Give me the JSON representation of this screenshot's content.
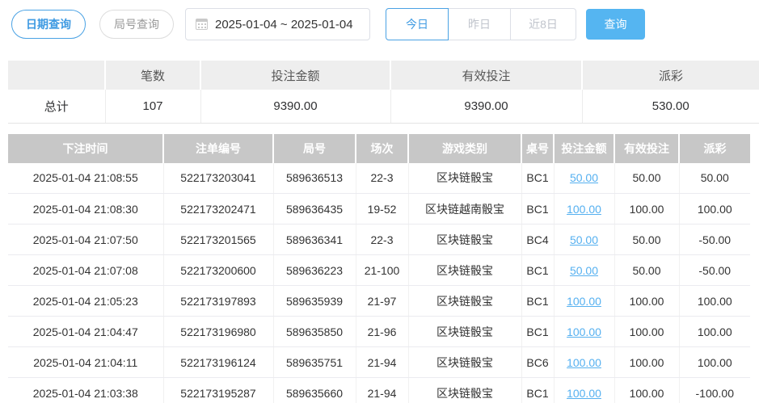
{
  "toolbar": {
    "date_query_label": "日期查询",
    "round_query_label": "局号查询",
    "date_range": "2025-01-04 ~ 2025-01-04",
    "today_label": "今日",
    "yesterday_label": "昨日",
    "last8days_label": "近8日",
    "search_label": "查询"
  },
  "summary": {
    "headers": [
      "",
      "笔数",
      "投注金额",
      "有效投注",
      "派彩"
    ],
    "row_label": "总计",
    "count": "107",
    "bet_amount": "9390.00",
    "valid_bet": "9390.00",
    "payout": "530.00"
  },
  "table": {
    "headers": [
      "下注时间",
      "注单编号",
      "局号",
      "场次",
      "游戏类别",
      "桌号",
      "投注金额",
      "有效投注",
      "派彩"
    ],
    "rows": [
      {
        "time": "2025-01-04 21:08:55",
        "order_id": "522173203041",
        "round_id": "589636513",
        "session": "22-3",
        "game_type": "区块链骰宝",
        "table_id": "BC1",
        "bet_amount": "50.00",
        "valid_bet": "50.00",
        "payout": "50.00"
      },
      {
        "time": "2025-01-04 21:08:30",
        "order_id": "522173202471",
        "round_id": "589636435",
        "session": "19-52",
        "game_type": "区块链越南骰宝",
        "table_id": "BC1",
        "bet_amount": "100.00",
        "valid_bet": "100.00",
        "payout": "100.00"
      },
      {
        "time": "2025-01-04 21:07:50",
        "order_id": "522173201565",
        "round_id": "589636341",
        "session": "22-3",
        "game_type": "区块链骰宝",
        "table_id": "BC4",
        "bet_amount": "50.00",
        "valid_bet": "50.00",
        "payout": "-50.00"
      },
      {
        "time": "2025-01-04 21:07:08",
        "order_id": "522173200600",
        "round_id": "589636223",
        "session": "21-100",
        "game_type": "区块链骰宝",
        "table_id": "BC1",
        "bet_amount": "50.00",
        "valid_bet": "50.00",
        "payout": "-50.00"
      },
      {
        "time": "2025-01-04 21:05:23",
        "order_id": "522173197893",
        "round_id": "589635939",
        "session": "21-97",
        "game_type": "区块链骰宝",
        "table_id": "BC1",
        "bet_amount": "100.00",
        "valid_bet": "100.00",
        "payout": "100.00"
      },
      {
        "time": "2025-01-04 21:04:47",
        "order_id": "522173196980",
        "round_id": "589635850",
        "session": "21-96",
        "game_type": "区块链骰宝",
        "table_id": "BC1",
        "bet_amount": "100.00",
        "valid_bet": "100.00",
        "payout": "100.00"
      },
      {
        "time": "2025-01-04 21:04:11",
        "order_id": "522173196124",
        "round_id": "589635751",
        "session": "21-94",
        "game_type": "区块链骰宝",
        "table_id": "BC6",
        "bet_amount": "100.00",
        "valid_bet": "100.00",
        "payout": "100.00"
      },
      {
        "time": "2025-01-04 21:03:38",
        "order_id": "522173195287",
        "round_id": "589635660",
        "session": "21-94",
        "game_type": "区块链骰宝",
        "table_id": "BC1",
        "bet_amount": "100.00",
        "valid_bet": "100.00",
        "payout": "-100.00"
      }
    ]
  },
  "colors": {
    "accent_blue": "#4aa2e4",
    "button_blue": "#55b5f1",
    "link_blue": "#55b0f0",
    "negative_red": "#f35a5a",
    "table_header_gray": "#c7c7c7",
    "summary_header_gray": "#eeeeee"
  }
}
